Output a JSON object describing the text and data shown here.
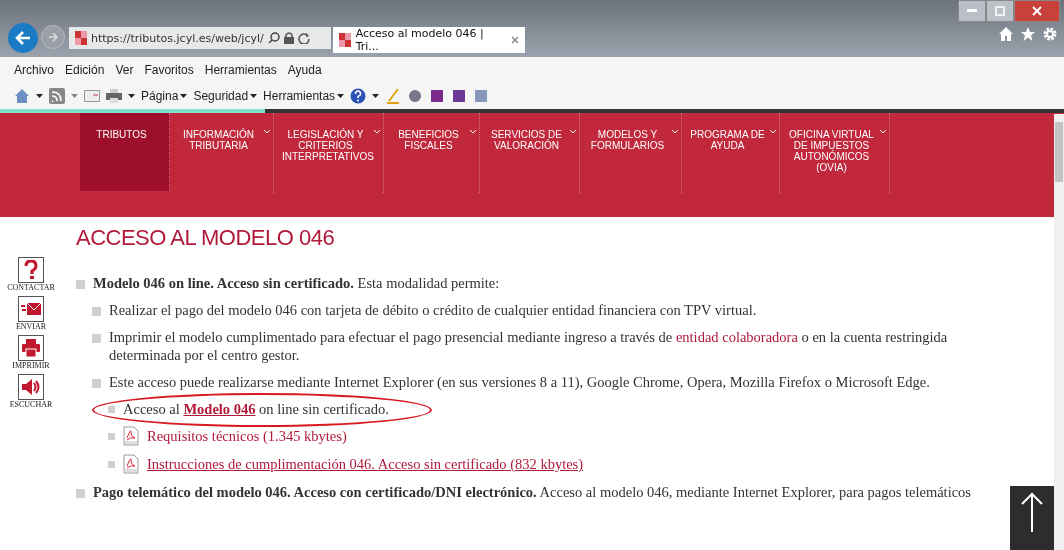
{
  "browser": {
    "address": "https://tributos.jcyl.es/web/jcyl/",
    "tab_title": "Acceso al modelo 046 | Tri...",
    "menu": [
      "Archivo",
      "Edición",
      "Ver",
      "Favoritos",
      "Herramientas",
      "Ayuda"
    ],
    "commands": [
      "Página",
      "Seguridad",
      "Herramientas"
    ]
  },
  "nav": [
    {
      "label": "TRIBUTOS",
      "selected": true,
      "has_menu": false
    },
    {
      "label": "INFORMACIÓN TRIBUTARIA",
      "selected": false,
      "has_menu": true
    },
    {
      "label": "LEGISLACIÓN Y CRITERIOS INTERPRETATIVOS",
      "selected": false,
      "has_menu": true
    },
    {
      "label": "BENEFICIOS FISCALES",
      "selected": false,
      "has_menu": true
    },
    {
      "label": "SERVICIOS DE VALORACIÓN",
      "selected": false,
      "has_menu": true
    },
    {
      "label": "MODELOS Y FORMULARIOS",
      "selected": false,
      "has_menu": true
    },
    {
      "label": "PROGRAMA DE AYUDA",
      "selected": false,
      "has_menu": true
    },
    {
      "label": "OFICINA VIRTUAL DE IMPUESTOS AUTONÓMICOS (OVIA)",
      "selected": false,
      "has_menu": true
    }
  ],
  "tools": [
    {
      "kind": "help",
      "label": "CONTACTAR"
    },
    {
      "kind": "mail",
      "label": "ENVIAR"
    },
    {
      "kind": "print",
      "label": "IMPRIMIR"
    },
    {
      "kind": "sound",
      "label": "ESCUCHAR"
    }
  ],
  "title": "ACCESO AL MODELO 046",
  "sections": [
    {
      "kind": "item",
      "parts": [
        {
          "kind": "text",
          "text": "**Modelo 046 on line. Acceso sin certificado.** Esta modalidad permite:"
        }
      ],
      "children": [
        {
          "kind": "item",
          "parts": [
            {
              "kind": "text",
              "text": "Realizar el pago del modelo 046 con tarjeta de débito o crédito de cualquier entidad financiera con TPV virtual."
            }
          ]
        },
        {
          "kind": "item",
          "parts": [
            {
              "kind": "text",
              "text": "Imprimir el modelo cumplimentado para efectuar el pago presencial mediante ingreso a través de"
            },
            {
              "kind": "link",
              "text": "entidad colaboradora"
            },
            {
              "kind": "text",
              "text": "o en la cuenta restringida determinada por el centro gestor."
            }
          ]
        },
        {
          "kind": "item",
          "parts": [
            {
              "kind": "text",
              "text": "Este acceso puede realizarse mediante Internet Explorer (en sus versiones 8 a 11), Google Chrome, Opera, Mozilla Firefox o Microsoft Edge."
            }
          ],
          "children": [
            {
              "kind": "item",
              "circled": true,
              "parts": [
                {
                  "kind": "text",
                  "text": "Acceso al"
                },
                {
                  "kind": "strong-link",
                  "text": "Modelo 046"
                },
                {
                  "kind": "text",
                  "text": "on line sin certificado."
                }
              ]
            },
            {
              "kind": "pdf",
              "parts": [
                {
                  "kind": "link",
                  "text": "Requisitos técnicos (1.345 kbytes)"
                }
              ]
            },
            {
              "kind": "pdf",
              "parts": [
                {
                  "kind": "underlined-link",
                  "text": "Instrucciones de cumplimentación 046. Acceso sin certificado (832 kbytes)"
                }
              ]
            }
          ]
        }
      ]
    },
    {
      "kind": "item",
      "parts": [
        {
          "kind": "text",
          "text": "**Pago telemático del modelo 046. Acceso con certificado/DNI electrónico.** Acceso al modelo 046, mediante Internet Explorer, para pagos telemáticos"
        }
      ]
    }
  ]
}
